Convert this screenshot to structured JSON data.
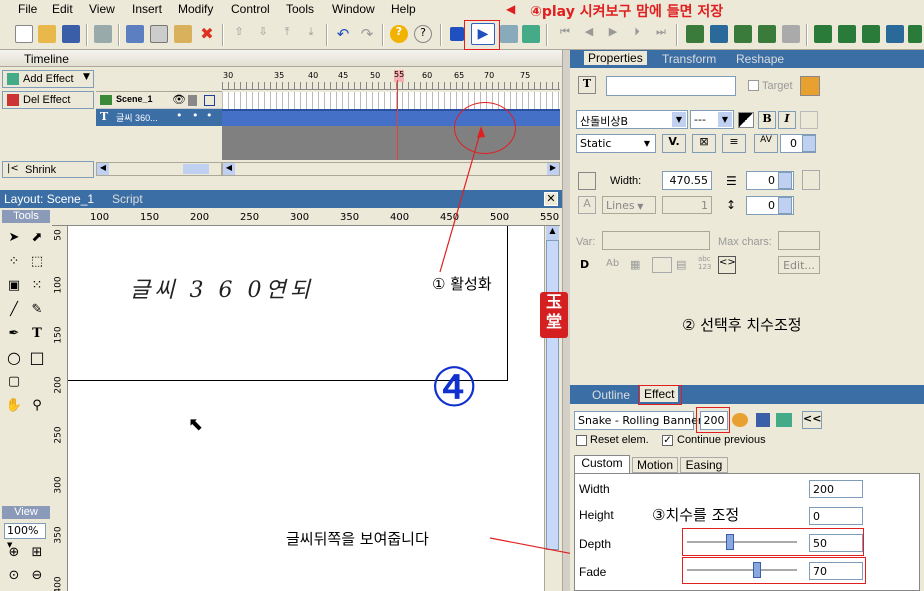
{
  "menu": [
    "File",
    "Edit",
    "View",
    "Insert",
    "Modify",
    "Control",
    "Tools",
    "Window",
    "Help"
  ],
  "annotations": {
    "play_save": "④play 시켜보구 맘에 들면 저장",
    "activate": "① 활성화",
    "select_resize": "② 선택후 치수조정",
    "adjust": "③치수를 조정",
    "shows_back": "글씨뒤쪽을 보여줍니다",
    "big_number": "④",
    "stamp": "玉堂"
  },
  "timeline": {
    "title": "Timeline",
    "add_effect": "Add Effect",
    "del_effect": "Del Effect",
    "shrink": "Shrink",
    "layers": [
      {
        "name": "Scene_1"
      },
      {
        "name": "글씨 360..."
      }
    ],
    "ruler": [
      "30",
      "35",
      "40",
      "45",
      "50",
      "55",
      "60",
      "65",
      "70",
      "75"
    ]
  },
  "layout": {
    "tab_active": "Layout: Scene_1",
    "tab_script": "Script",
    "tools_label": "Tools",
    "view_label": "View",
    "zoom": "100%",
    "hruler": [
      "100",
      "150",
      "200",
      "250",
      "300",
      "350",
      "400",
      "450",
      "500",
      "550"
    ],
    "vruler": [
      "50",
      "100",
      "150",
      "200",
      "250",
      "300",
      "350",
      "400",
      "450"
    ],
    "canvas_text": "글씨  3 6 0연되"
  },
  "properties": {
    "tabs": [
      "Properties",
      "Transform",
      "Reshape"
    ],
    "target_label": "Target",
    "font": "산돌비상B",
    "size": "---",
    "bold": "B",
    "italic": "I",
    "text_type": "Static",
    "kerning": "0",
    "width_label": "Width:",
    "width_value": "470.55",
    "indent_value": "0",
    "lines_label": "Lines",
    "lines_value": "1",
    "spacing_value": "0",
    "var_label": "Var:",
    "maxchars_label": "Max chars:",
    "edit_label": "Edit..."
  },
  "effect": {
    "tabs": [
      "Outline",
      "Effect"
    ],
    "effect_name": "Snake - Rolling Banner",
    "frames": "200",
    "reset_label": "Reset elem.",
    "continue_label": "Continue previous",
    "subtabs": [
      "Custom",
      "Motion",
      "Easing"
    ],
    "rows": [
      {
        "label": "Width",
        "value": "200"
      },
      {
        "label": "Height",
        "value": "0"
      },
      {
        "label": "Depth",
        "value": "50",
        "slider": 0.35
      },
      {
        "label": "Fade",
        "value": "70",
        "slider": 0.6
      }
    ]
  }
}
